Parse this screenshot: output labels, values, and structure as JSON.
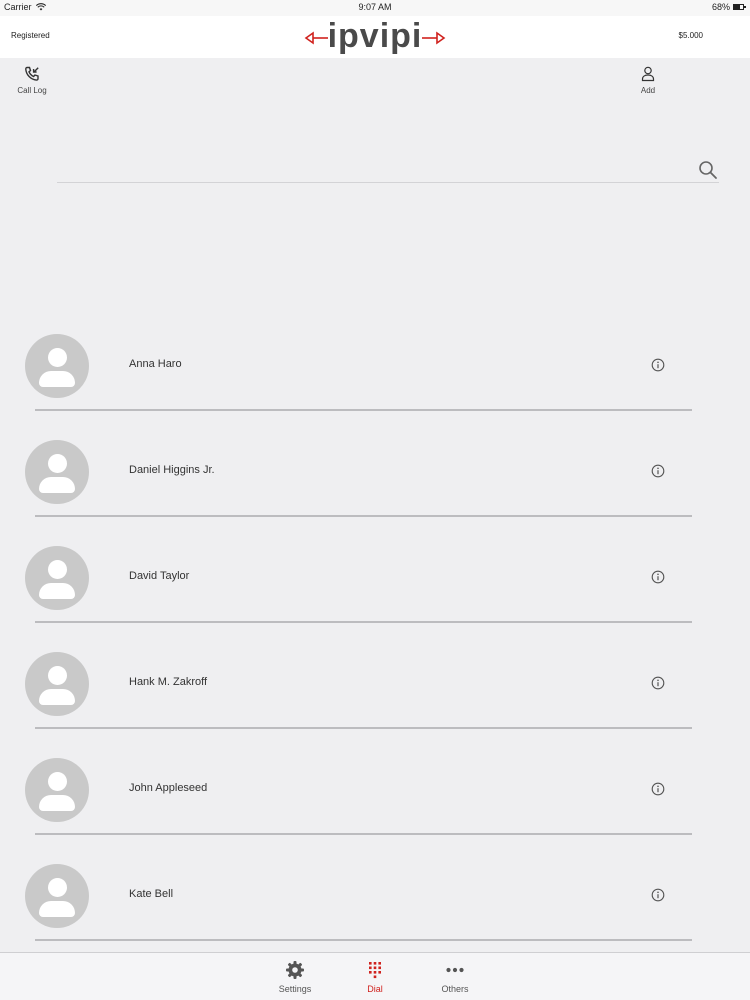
{
  "status_bar": {
    "carrier": "Carrier",
    "time": "9:07 AM",
    "battery": "68%"
  },
  "header": {
    "registration_status": "Registered",
    "logo": "ipvipi",
    "balance": "$5.000"
  },
  "toolbar": {
    "call_log_label": "Call Log",
    "add_label": "Add"
  },
  "search": {
    "placeholder": "",
    "value": ""
  },
  "contacts": [
    {
      "name": "Anna Haro"
    },
    {
      "name": "Daniel Higgins Jr."
    },
    {
      "name": "David Taylor"
    },
    {
      "name": "Hank M. Zakroff"
    },
    {
      "name": "John Appleseed"
    },
    {
      "name": "Kate Bell"
    }
  ],
  "tab_bar": {
    "tabs": [
      {
        "label": "Settings",
        "icon": "gear-icon",
        "active": false
      },
      {
        "label": "Dial",
        "icon": "keypad-icon",
        "active": true
      },
      {
        "label": "Others",
        "icon": "more-icon",
        "active": false
      }
    ]
  },
  "colors": {
    "accent": "#d0221e",
    "logo_text": "#4a4a4a",
    "background": "#efeff1",
    "avatar": "#c9c9c9"
  }
}
